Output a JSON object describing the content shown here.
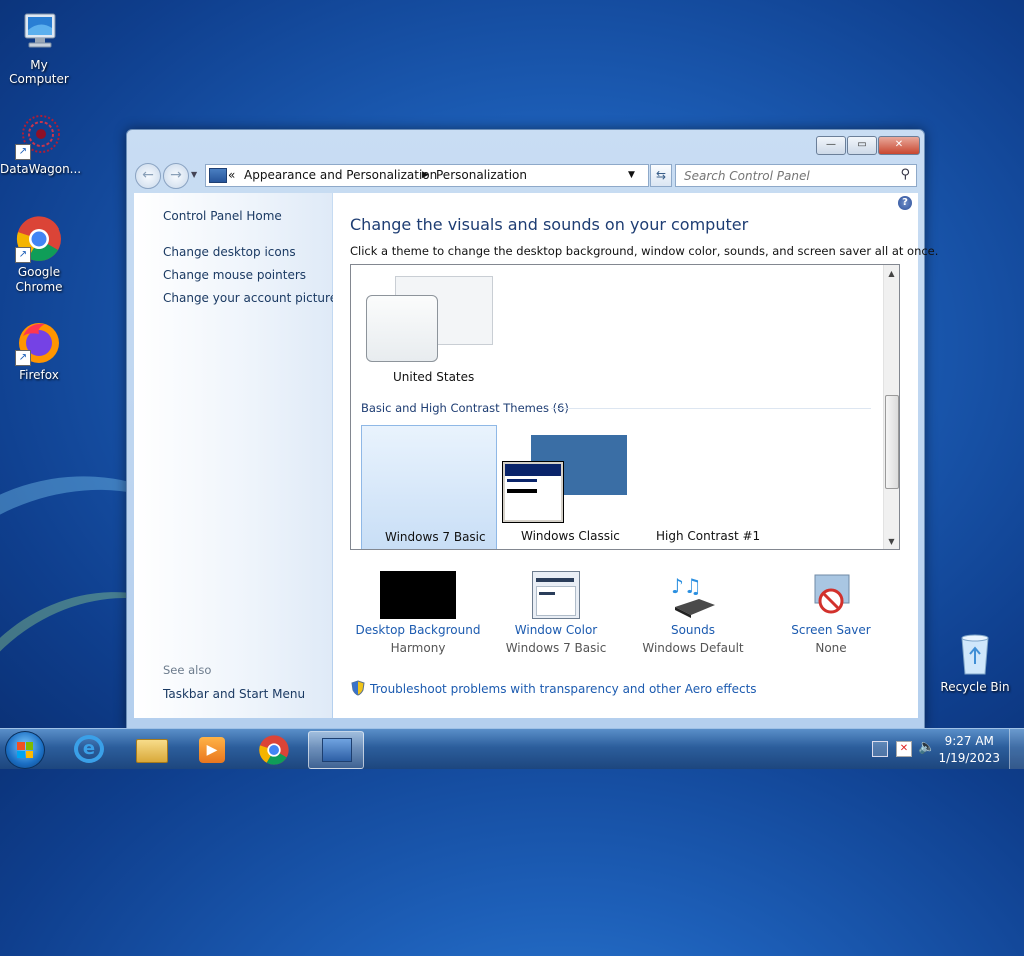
{
  "desktop": {
    "icons": [
      {
        "label": "My Computer"
      },
      {
        "label": "DataWagon..."
      },
      {
        "label": "Google Chrome"
      },
      {
        "label": "Firefox"
      },
      {
        "label": "Recycle Bin"
      }
    ]
  },
  "window": {
    "breadcrumb": {
      "prefix": "«",
      "items": [
        "Appearance and Personalization",
        "Personalization"
      ]
    },
    "search": {
      "placeholder": "Search Control Panel"
    },
    "sidebar": {
      "links": [
        "Control Panel Home",
        "Change desktop icons",
        "Change mouse pointers",
        "Change your account picture"
      ],
      "see_also_label": "See also",
      "see_also_links": [
        "Taskbar and Start Menu"
      ]
    },
    "main": {
      "title": "Change the visuals and sounds on your computer",
      "subtitle": "Click a theme to change the desktop background, window color, sounds, and screen saver all at once.",
      "my_theme": "United States",
      "group_header": "Basic and High Contrast Themes (6)",
      "themes": [
        "Windows 7 Basic",
        "Windows Classic",
        "High Contrast #1"
      ],
      "selected_theme": "Windows 7 Basic",
      "settings": [
        {
          "label": "Desktop Background",
          "value": "Harmony"
        },
        {
          "label": "Window Color",
          "value": "Windows 7 Basic"
        },
        {
          "label": "Sounds",
          "value": "Windows Default"
        },
        {
          "label": "Screen Saver",
          "value": "None"
        }
      ],
      "troubleshoot_link": "Troubleshoot problems with transparency and other Aero effects"
    }
  },
  "taskbar": {
    "clock_time": "9:27 AM",
    "clock_date": "1/19/2023"
  },
  "colors": {
    "link": "#1c5bb0",
    "heading": "#1e3d73",
    "selection": "#c8def6"
  }
}
